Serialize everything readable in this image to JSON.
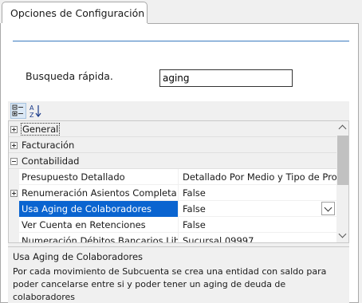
{
  "tab": {
    "label": "Opciones de Configuración"
  },
  "search": {
    "label": "Busqueda rápida.",
    "value": "aging"
  },
  "toolbar": {
    "categorized_icon": "categorized-view-icon",
    "alpha_icon": "sort-alphabetical-icon"
  },
  "property_grid": {
    "rows": [
      {
        "type": "category",
        "label": "General",
        "expanded": false
      },
      {
        "type": "category",
        "label": "Facturación",
        "expanded": false
      },
      {
        "type": "category",
        "label": "Contabilidad",
        "expanded": true
      },
      {
        "type": "property",
        "name": "Presupuesto Detallado",
        "value": "Detallado Por Medio y Tipo de Prod"
      },
      {
        "type": "property",
        "name": "Renumeración Asientos Completa",
        "value": "False",
        "expandable": true
      },
      {
        "type": "property",
        "name": "Usa Aging de Colaboradores",
        "value": "False",
        "selected": true
      },
      {
        "type": "property",
        "name": "Ver Cuenta en Retenciones",
        "value": "False"
      },
      {
        "type": "property",
        "name": "Numeración Débitos Bancarios Libro Co",
        "value": "Sucursal 09997"
      }
    ]
  },
  "description": {
    "title": "Usa Aging de Colaboradores",
    "text": "Por cada movimiento de Subcuenta se crea una entidad con saldo para poder cancelarse entre si y poder tener un aging de deuda de colaboradores"
  },
  "colors": {
    "selection": "#0a64d0",
    "separator": "#3a7bbf"
  }
}
